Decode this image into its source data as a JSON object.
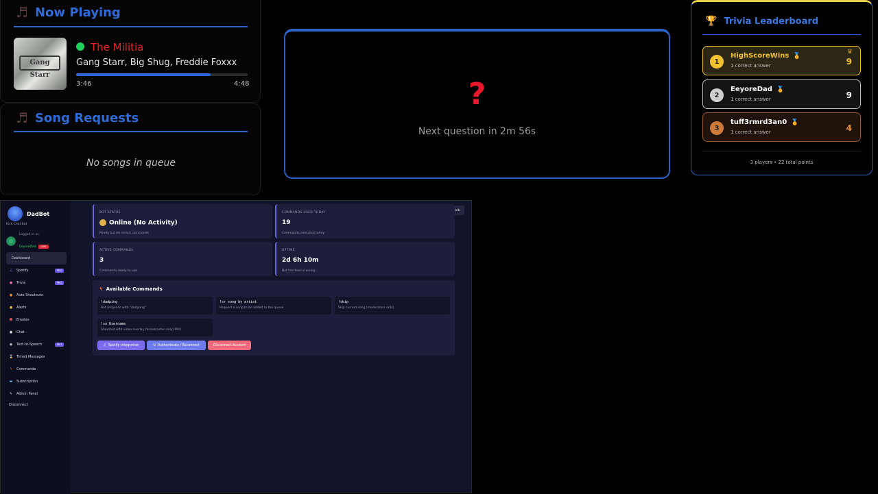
{
  "now_playing": {
    "title": "Now Playing",
    "song": "The Militia",
    "artist": "Gang Starr, Big Shug, Freddie Foxxx",
    "elapsed": "3:46",
    "duration": "4:48",
    "progress": 0.785,
    "album_logo_text": "Gang Starr"
  },
  "song_requests": {
    "title": "Song Requests",
    "empty_text": "No songs in queue"
  },
  "trivia": {
    "question_mark": "?",
    "next_text": "Next question in 2m 56s"
  },
  "leaderboard": {
    "title": "Trivia Leaderboard",
    "players": [
      {
        "rank": "1",
        "name": "HighScoreWins",
        "sub": "1 correct answer",
        "score": "9",
        "rank_color": "#f2c12e",
        "row_bg": "#2b2714",
        "border": "#f2c12e",
        "name_color": "#f2c12e",
        "score_color": "#f2c12e"
      },
      {
        "rank": "2",
        "name": "EeyoreDad",
        "sub": "1 correct answer",
        "score": "9",
        "rank_color": "#cfcfcf",
        "row_bg": "#131313",
        "border": "#bdbdbd",
        "name_color": "#ffffff",
        "score_color": "#ffffff"
      },
      {
        "rank": "3",
        "name": "tuff3rmrd3an0",
        "sub": "1 correct answer",
        "score": "4",
        "rank_color": "#cd7a3a",
        "row_bg": "#20130b",
        "border": "#9a5a2a",
        "name_color": "#ffffff",
        "score_color": "#e08a3a"
      }
    ],
    "footer": "3 players • 22 total points"
  },
  "dashboard": {
    "brand": "DadBot",
    "tagline": "Kick Chat Bot",
    "logged_in_label": "Logged in as",
    "username": "EeyoreDad",
    "live_badge": "LIVE",
    "nav": [
      {
        "label": "Dashboard",
        "icon": "",
        "pro": "",
        "active": true
      },
      {
        "label": "Spotify",
        "icon": "♫",
        "pro": "PRO",
        "active": false
      },
      {
        "label": "Trivia",
        "icon": "●",
        "pro": "PRO",
        "active": false
      },
      {
        "label": "Auto Shoutouts",
        "icon": "●",
        "pro": "",
        "active": false
      },
      {
        "label": "Alerts",
        "icon": "●",
        "pro": "",
        "active": false
      },
      {
        "label": "Emotes",
        "icon": "☻",
        "pro": "",
        "active": false
      },
      {
        "label": "Chat",
        "icon": "●",
        "pro": "",
        "active": false
      },
      {
        "label": "Text-to-Speech",
        "icon": "◉",
        "pro": "PRO",
        "active": false
      },
      {
        "label": "Timed Messages",
        "icon": "⌛",
        "pro": "",
        "active": false
      },
      {
        "label": "Commands",
        "icon": "ϟ",
        "pro": "",
        "active": false
      },
      {
        "label": "Subscription",
        "icon": "▬",
        "pro": "",
        "active": false
      },
      {
        "label": "Admin Panel",
        "icon": "✎",
        "pro": "",
        "active": false
      }
    ],
    "disconnect": "Disconnect",
    "dark_toggle": "Dark",
    "stats": [
      {
        "label": "BOT STATUS",
        "value": "Online (No Activity)",
        "desc": "Ready but no recent commands"
      },
      {
        "label": "COMMANDS USED TODAY",
        "value": "19",
        "desc": "Commands executed today"
      },
      {
        "label": "ACTIVE COMMANDS",
        "value": "3",
        "desc": "Commands ready to use"
      },
      {
        "label": "UPTIME",
        "value": "2d 6h 10m",
        "desc": "Bot has been running"
      }
    ],
    "commands_title": "Available Commands",
    "commands": [
      {
        "name": "!dadping",
        "desc": "Bot responds with \"dadpong\""
      },
      {
        "name": "!sr song by artist",
        "desc": "Request a song to be added to the queue"
      },
      {
        "name": "!skip",
        "desc": "Skip current song (moderators only)"
      },
      {
        "name": "!so Username",
        "desc": "Shoutout with video overlay (broadcaster only) PRO"
      }
    ],
    "buttons": [
      {
        "label": "Spotify Integration",
        "color": "#7c6cf0"
      },
      {
        "label": "Authenticate / Reconnect",
        "color": "#6e7cf0"
      },
      {
        "label": "Disconnect Account",
        "color": "#f06a7c"
      }
    ]
  }
}
